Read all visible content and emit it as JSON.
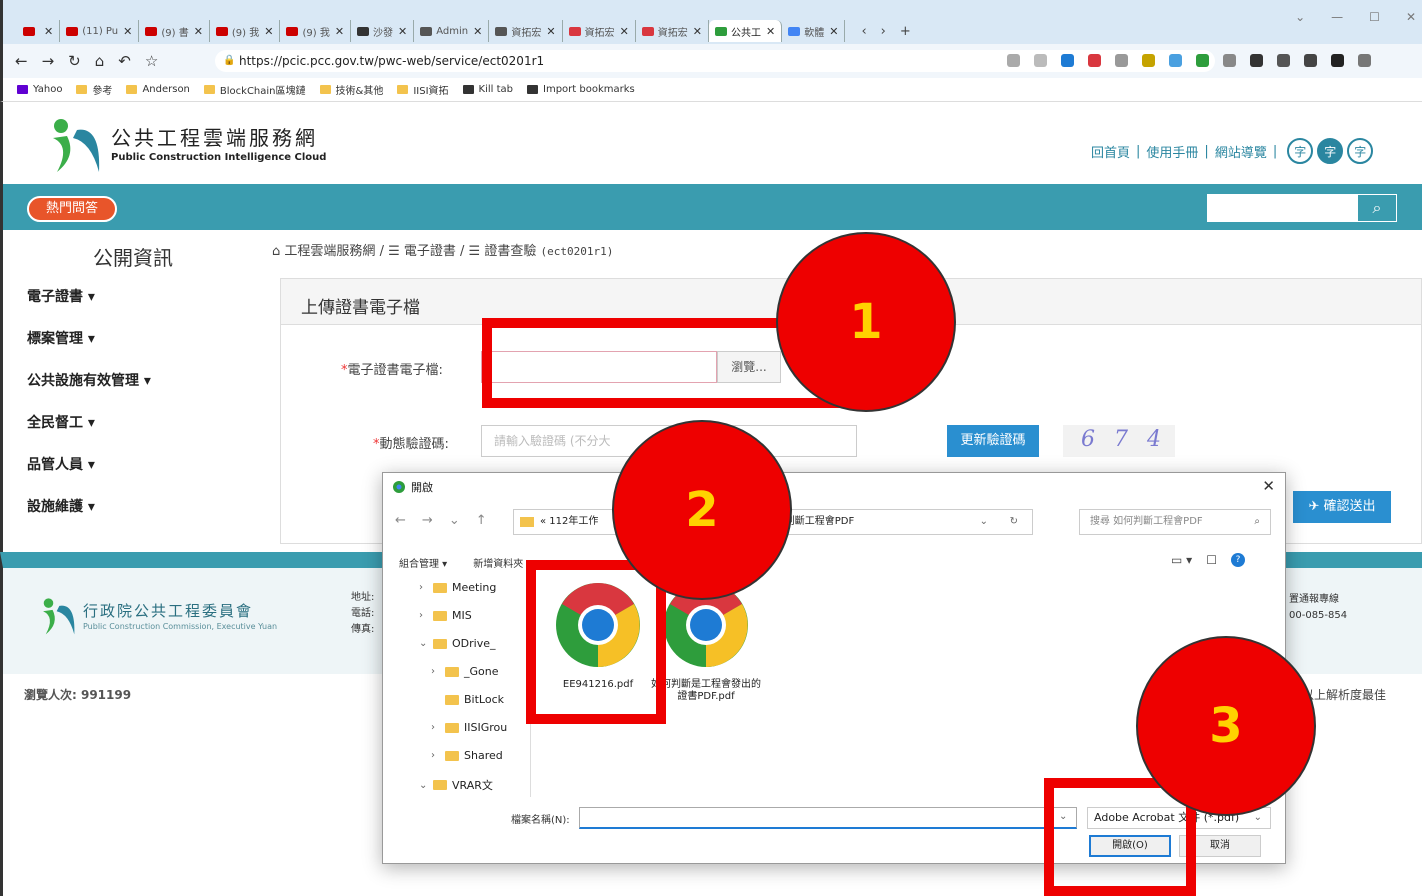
{
  "browser": {
    "tabs": [
      {
        "label": "",
        "color": "#cc0000"
      },
      {
        "label": "(11) Pu",
        "color": "#cc0000"
      },
      {
        "label": "(9) 書",
        "color": "#cc0000"
      },
      {
        "label": "(9) 我",
        "color": "#cc0000"
      },
      {
        "label": "(9) 我",
        "color": "#cc0000"
      },
      {
        "label": "沙發",
        "color": "#333333"
      },
      {
        "label": "Admin",
        "color": "#555555"
      },
      {
        "label": "資拓宏",
        "color": "#555555"
      },
      {
        "label": "資拓宏",
        "color": "#d9373f"
      },
      {
        "label": "資拓宏",
        "color": "#d9373f"
      },
      {
        "label": "公共工",
        "color": "#2e9d3c"
      },
      {
        "label": "軟體",
        "color": "#4285f4"
      }
    ],
    "url": "https://pcic.pcc.gov.tw/pwc-web/service/ect0201r1",
    "bookmarks": [
      "Yahoo",
      "參考",
      "Anderson",
      "BlockChain區塊鏈",
      "技術&其他",
      "IISI資拓",
      "Kill tab",
      "Import bookmarks"
    ]
  },
  "site": {
    "title": "公共工程雲端服務網",
    "subtitle": "Public Construction Intelligence Cloud",
    "top_links": [
      "回首頁",
      "使用手冊",
      "網站導覽"
    ],
    "font_sizes": [
      "字",
      "字",
      "字"
    ],
    "hot_qa": "熱門問答",
    "search_icon": "search-icon"
  },
  "left_nav": {
    "title": "公開資訊",
    "items": [
      "電子證書 ▾",
      "標案管理 ▾",
      "公共設施有效管理 ▾",
      "全民督工 ▾",
      "品管人員 ▾",
      "設施維護 ▾"
    ]
  },
  "breadcrumb": {
    "home": "工程雲端服務網",
    "level1": "電子證書",
    "level2": "證書查驗",
    "code": "(ect0201r1)"
  },
  "panel": {
    "title": "上傳證書電子檔",
    "file_label": "電子證書電子檔:",
    "browse": "瀏覽...",
    "captcha_label": "動態驗證碼:",
    "captcha_placeholder": "請輸入驗證碼 (不分大",
    "refresh": "更新驗證碼",
    "captcha_text": "6 7 4",
    "submit": "確認送出"
  },
  "footer": {
    "org": "行政院公共工程委員會",
    "org_en": "Public Construction Commission, Executive Yuan",
    "addr_labels": [
      "地址:",
      "電話:",
      "傳真:"
    ],
    "hotline": [
      "置通報專線",
      "00-085-854"
    ],
    "visits": "瀏覽人次: 991199",
    "resolution": "以上解析度最佳"
  },
  "dialog": {
    "title": "開啟",
    "path_start": "« 112年工作",
    "path_end": "› 如何判斷工程會PDF",
    "search_placeholder": "搜尋 如何判斷工程會PDF",
    "organize": "組合管理 ▾",
    "new_folder": "新增資料夾",
    "tree": [
      "Meeting",
      "MIS",
      "ODrive_",
      "_Gone",
      "BitLock",
      "IISIGrou",
      "Shared",
      "VRAR文"
    ],
    "files": [
      "EE941216.pdf",
      "如何判斷是工程會發出的證書PDF.pdf"
    ],
    "filename_label": "檔案名稱(N):",
    "filter": "Adobe Acrobat 文件 (*.pdf)",
    "open": "開啟(O)",
    "cancel": "取消"
  },
  "annotations": [
    "1",
    "2",
    "3"
  ]
}
